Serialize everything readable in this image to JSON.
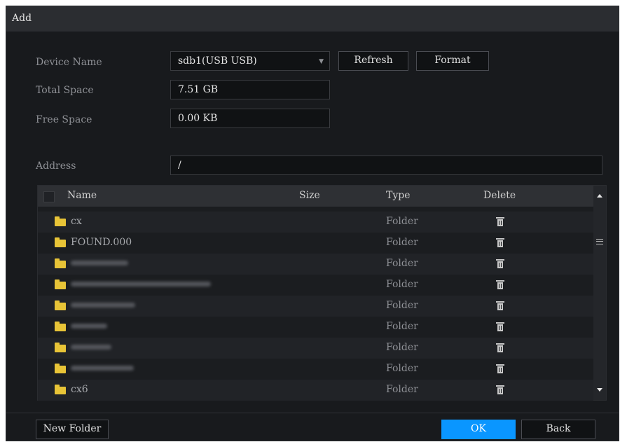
{
  "window": {
    "title": "Add"
  },
  "form": {
    "device_name_label": "Device Name",
    "device_name_value": "sdb1(USB USB)",
    "total_space_label": "Total Space",
    "total_space_value": "7.51 GB",
    "free_space_label": "Free Space",
    "free_space_value": "0.00 KB",
    "address_label": "Address",
    "address_value": "/",
    "refresh_label": "Refresh",
    "format_label": "Format"
  },
  "table": {
    "headers": {
      "name": "Name",
      "size": "Size",
      "type": "Type",
      "delete": "Delete"
    },
    "rows": [
      {
        "name": "cx",
        "size": "",
        "type": "Folder"
      },
      {
        "name": "FOUND.000",
        "size": "",
        "type": "Folder"
      },
      {
        "name": "",
        "size": "",
        "type": "Folder"
      },
      {
        "name": "",
        "size": "",
        "type": "Folder"
      },
      {
        "name": "",
        "size": "",
        "type": "Folder"
      },
      {
        "name": "",
        "size": "",
        "type": "Folder"
      },
      {
        "name": "",
        "size": "",
        "type": "Folder"
      },
      {
        "name": "",
        "size": "",
        "type": "Folder"
      },
      {
        "name": "cx6",
        "size": "",
        "type": "Folder"
      }
    ]
  },
  "footer": {
    "new_folder_label": "New Folder",
    "ok_label": "OK",
    "back_label": "Back"
  },
  "colors": {
    "accent": "#0a96ff",
    "folder": "#e8c437",
    "background": "#181a1d"
  },
  "icons": {
    "folder": "folder-icon",
    "delete": "trash-icon",
    "dropdown": "chevron-down-icon",
    "scroll_up": "arrow-up-icon",
    "scroll_down": "arrow-down-icon"
  }
}
